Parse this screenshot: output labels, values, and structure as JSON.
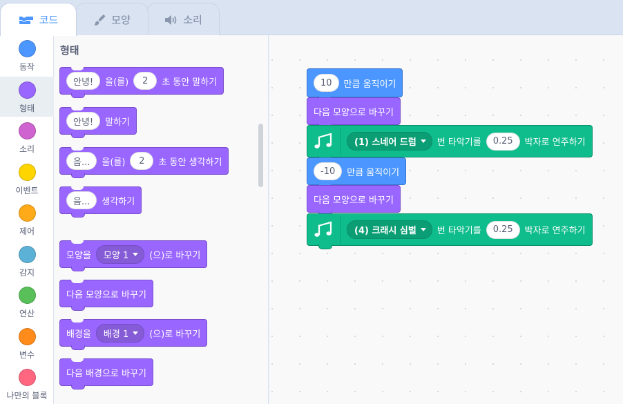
{
  "tabs": [
    {
      "label": "코드",
      "icon": "code-icon",
      "active": true
    },
    {
      "label": "모양",
      "icon": "paintbrush-icon",
      "active": false
    },
    {
      "label": "소리",
      "icon": "speaker-icon",
      "active": false
    }
  ],
  "categories": [
    {
      "label": "동작",
      "color": "#4c97ff"
    },
    {
      "label": "형태",
      "color": "#9966ff",
      "selected": true
    },
    {
      "label": "소리",
      "color": "#cf63cf"
    },
    {
      "label": "이벤트",
      "color": "#ffd500"
    },
    {
      "label": "제어",
      "color": "#ffab19"
    },
    {
      "label": "감지",
      "color": "#5cb1d6"
    },
    {
      "label": "연산",
      "color": "#59c059"
    },
    {
      "label": "변수",
      "color": "#ff8c1a"
    },
    {
      "label": "나만의 블록",
      "color": "#ff6680"
    }
  ],
  "palette": {
    "title": "형태",
    "say_for": {
      "text": "안녕!",
      "post": "을(를)",
      "secs": "2",
      "tail": "초 동안 말하기"
    },
    "say": {
      "text": "안녕!",
      "tail": "말하기"
    },
    "think_for": {
      "text": "음...",
      "post": "을(를)",
      "secs": "2",
      "tail": "초 동안 생각하기"
    },
    "think": {
      "text": "음...",
      "tail": "생각하기"
    },
    "switch_costume": {
      "pre": "모양을",
      "value": "모양 1",
      "tail": "(으)로 바꾸기"
    },
    "next_costume": {
      "label": "다음 모양으로 바꾸기"
    },
    "switch_backdrop": {
      "pre": "배경을",
      "value": "배경 1",
      "tail": "(으)로 바꾸기"
    },
    "next_backdrop": {
      "label": "다음 배경으로 바꾸기"
    }
  },
  "script": {
    "move1": {
      "steps": "10",
      "tail": "만큼 움직이기"
    },
    "next1": {
      "label": "다음 모양으로 바꾸기"
    },
    "drum1": {
      "drum": "(1) 스네어 드럼",
      "mid": "번 타악기를",
      "beats": "0.25",
      "tail": "박자로 연주하기"
    },
    "move2": {
      "steps": "-10",
      "tail": "만큼 움직이기"
    },
    "next2": {
      "label": "다음 모양으로 바꾸기"
    },
    "drum2": {
      "drum": "(4) 크래시 심벌",
      "mid": "번 타악기를",
      "beats": "0.25",
      "tail": "박자로 연주하기"
    }
  }
}
